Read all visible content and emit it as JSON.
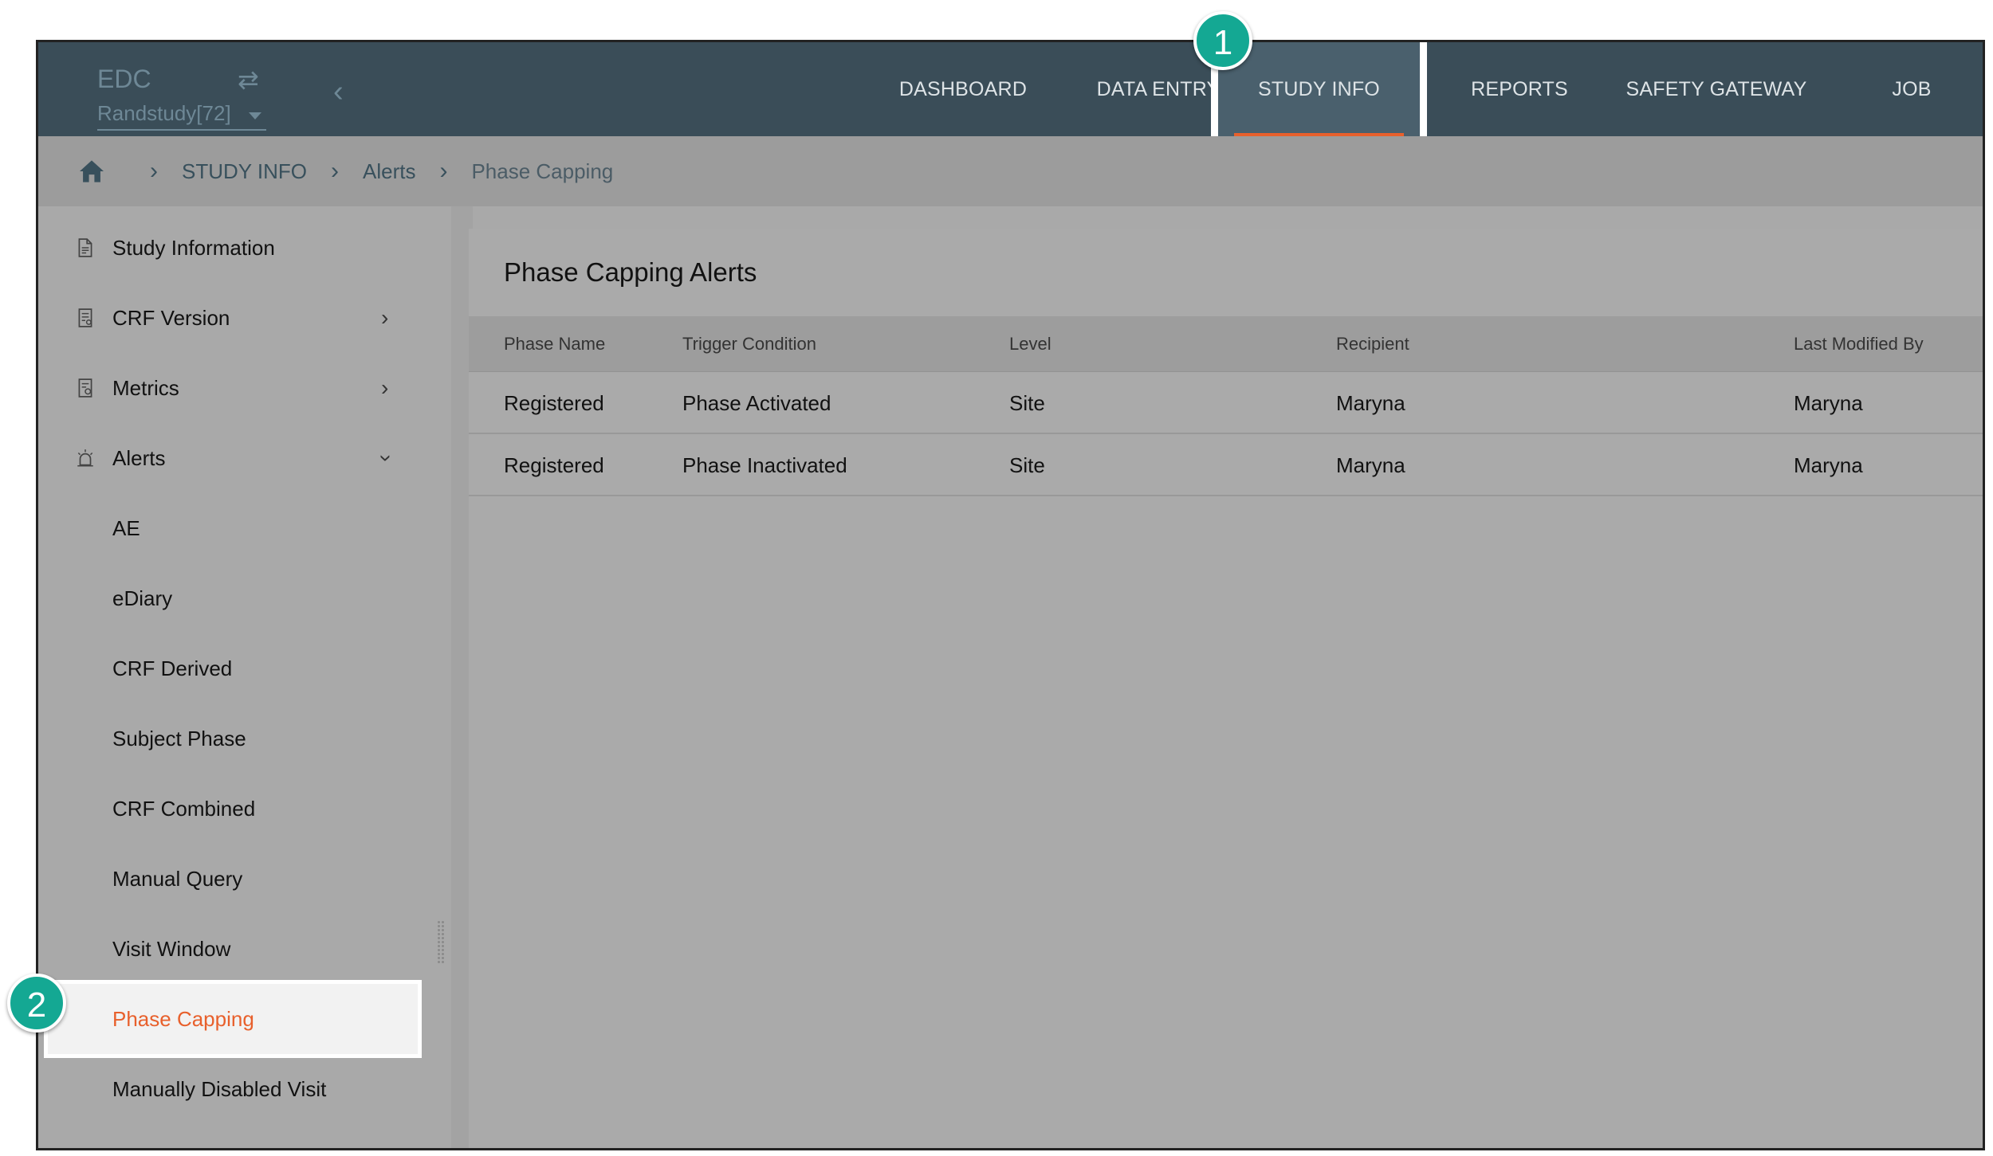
{
  "header": {
    "app_name": "EDC",
    "swap_icon": "swap-arrows-icon",
    "study_selector": "Randstudy[72]",
    "nav": [
      {
        "label": "DASHBOARD"
      },
      {
        "label": "DATA ENTRY"
      },
      {
        "label": "STUDY INFO",
        "active": true
      },
      {
        "label": "REPORTS"
      },
      {
        "label": "SAFETY GATEWAY"
      },
      {
        "label": "JOB"
      }
    ]
  },
  "badges": {
    "one": "1",
    "two": "2"
  },
  "breadcrumb": {
    "home_icon": "home-icon",
    "items": [
      "STUDY INFO",
      "Alerts",
      "Phase Capping"
    ]
  },
  "sidebar": {
    "items": [
      {
        "label": "Study Information",
        "icon": "document-icon"
      },
      {
        "label": "CRF Version",
        "icon": "crf-icon",
        "expandable": true
      },
      {
        "label": "Metrics",
        "icon": "metrics-icon",
        "expandable": true
      },
      {
        "label": "Alerts",
        "icon": "alarm-icon",
        "expanded": true
      }
    ],
    "sub_items": [
      "AE",
      "eDiary",
      "CRF Derived",
      "Subject Phase",
      "CRF Combined",
      "Manual Query",
      "Visit Window",
      "Phase Capping",
      "Manually Disabled Visit"
    ],
    "selected": "Phase Capping"
  },
  "main": {
    "title": "Phase Capping Alerts",
    "columns": [
      "Phase Name",
      "Trigger Condition",
      "Level",
      "Recipient",
      "Last Modified By"
    ],
    "rows": [
      [
        "Registered",
        "Phase Activated",
        "Site",
        "Maryna",
        "Maryna"
      ],
      [
        "Registered",
        "Phase Inactivated",
        "Site",
        "Maryna",
        "Maryna"
      ]
    ]
  },
  "colors": {
    "topbar": "#3a4d58",
    "accent": "#e8602c",
    "badge": "#14a893",
    "overlay": "#a9a9a9"
  }
}
